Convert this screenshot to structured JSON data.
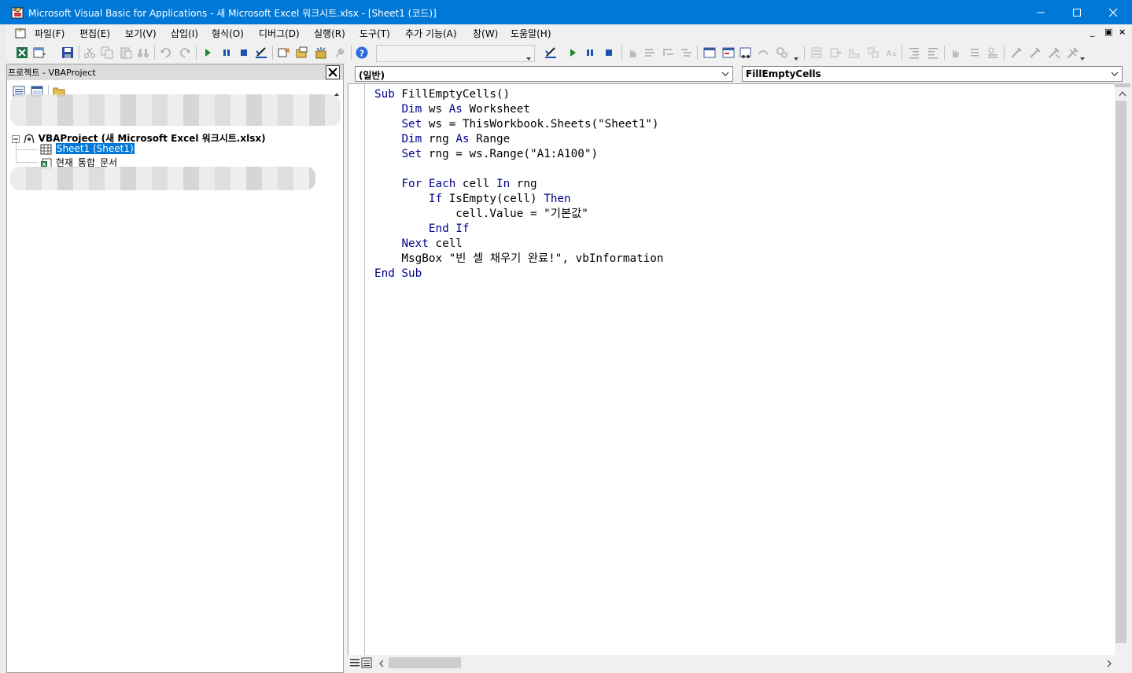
{
  "window": {
    "title": "Microsoft Visual Basic for Applications - 새 Microsoft Excel 워크시트.xlsx - [Sheet1 (코드)]",
    "controls": [
      "minimize-icon",
      "maximize-icon",
      "close-icon"
    ]
  },
  "menubar": {
    "items": [
      "파일(F)",
      "편집(E)",
      "보기(V)",
      "삽입(I)",
      "형식(O)",
      "디버그(D)",
      "실행(R)",
      "도구(T)",
      "추가 기능(A)",
      "창(W)",
      "도움말(H)"
    ],
    "mdi_controls": [
      "_",
      "▣",
      "×"
    ]
  },
  "toolbar": {
    "icons": [
      "excel-icon",
      "insert-userform-icon",
      "save-icon",
      "cut-icon",
      "copy-icon",
      "paste-icon",
      "find-icon",
      "undo-icon",
      "redo-icon",
      "run-icon",
      "break-icon",
      "reset-icon",
      "design-mode-icon",
      "project-explorer-icon",
      "properties-icon",
      "object-browser-icon",
      "toolbox-icon",
      "help-icon"
    ],
    "combo_value": "",
    "icons_right": [
      "design-mode-icon",
      "run-icon",
      "break-icon",
      "reset-icon",
      "toggle-breakpoint-icon",
      "step-into-icon",
      "step-over-icon",
      "step-out-icon",
      "locals-icon",
      "immediate-icon",
      "watch-icon",
      "quick-watch-icon",
      "call-stack-icon",
      "list-properties-icon",
      "list-constants-icon",
      "quick-info-icon",
      "parameter-info-icon",
      "complete-word-icon",
      "indent-icon",
      "outdent-icon",
      "toggle-bookmark-icon",
      "next-bookmark-icon",
      "previous-bookmark-icon",
      "clear-bookmarks-icon",
      "comment-block-icon",
      "uncomment-block-icon"
    ]
  },
  "project_panel": {
    "title": "프로젝트 - VBAProject",
    "tree": {
      "project_label": "VBAProject (새 Microsoft Excel 워크시트.xlsx)",
      "sheet_label": "Sheet1 (Sheet1)",
      "workbook_label": "현재_통합_문서"
    }
  },
  "code_window": {
    "object_dropdown": "(일반)",
    "procedure_dropdown": "FillEmptyCells",
    "lines": [
      [
        {
          "t": "Sub",
          "k": true
        },
        {
          "t": " FillEmptyCells()",
          "k": false
        }
      ],
      [
        {
          "t": "    ",
          "k": false
        },
        {
          "t": "Dim",
          "k": true
        },
        {
          "t": " ws ",
          "k": false
        },
        {
          "t": "As",
          "k": true
        },
        {
          "t": " Worksheet",
          "k": false
        }
      ],
      [
        {
          "t": "    ",
          "k": false
        },
        {
          "t": "Set",
          "k": true
        },
        {
          "t": " ws = ThisWorkbook.Sheets(\"Sheet1\")",
          "k": false
        }
      ],
      [
        {
          "t": "    ",
          "k": false
        },
        {
          "t": "Dim",
          "k": true
        },
        {
          "t": " rng ",
          "k": false
        },
        {
          "t": "As",
          "k": true
        },
        {
          "t": " Range",
          "k": false
        }
      ],
      [
        {
          "t": "    ",
          "k": false
        },
        {
          "t": "Set",
          "k": true
        },
        {
          "t": " rng = ws.Range(\"A1:A100\")",
          "k": false
        }
      ],
      [
        {
          "t": "",
          "k": false
        }
      ],
      [
        {
          "t": "    ",
          "k": false
        },
        {
          "t": "For Each",
          "k": true
        },
        {
          "t": " cell ",
          "k": false
        },
        {
          "t": "In",
          "k": true
        },
        {
          "t": " rng",
          "k": false
        }
      ],
      [
        {
          "t": "        ",
          "k": false
        },
        {
          "t": "If",
          "k": true
        },
        {
          "t": " IsEmpty(cell) ",
          "k": false
        },
        {
          "t": "Then",
          "k": true
        }
      ],
      [
        {
          "t": "            cell.Value = \"기본값\"",
          "k": false
        }
      ],
      [
        {
          "t": "        ",
          "k": false
        },
        {
          "t": "End If",
          "k": true
        }
      ],
      [
        {
          "t": "    ",
          "k": false
        },
        {
          "t": "Next",
          "k": true
        },
        {
          "t": " cell",
          "k": false
        }
      ],
      [
        {
          "t": "    MsgBox \"빈 셀 채우기 완료!\", vbInformation",
          "k": false
        }
      ],
      [
        {
          "t": "End Sub",
          "k": true
        }
      ]
    ]
  },
  "colors": {
    "titlebar": "#0078d7",
    "keyword": "#00008b",
    "selection": "#0078d7"
  }
}
